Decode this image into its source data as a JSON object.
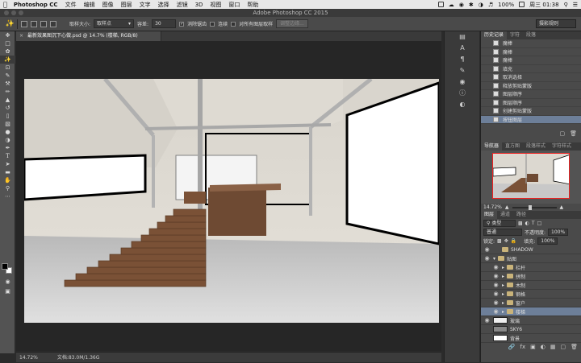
{
  "mac_menubar": {
    "app_name": "Photoshop CC",
    "menus": [
      "文件",
      "编辑",
      "图像",
      "图层",
      "文字",
      "选择",
      "滤镜",
      "3D",
      "视图",
      "窗口",
      "帮助"
    ],
    "battery": "100%",
    "clock": "周三 01:38"
  },
  "window": {
    "title": "Adobe Photoshop CC 2015"
  },
  "options_bar": {
    "brush_size_label": "画笔大小:",
    "sample_label": "取样大小:",
    "sample_value": "取样点",
    "tolerance_label": "容差:",
    "tolerance_value": "30",
    "antialias_label": "消除锯齿",
    "contiguous_label": "连续",
    "all_layers_label": "对所有图层取样",
    "refine_edge_label": "调整边缘...",
    "workspace": "摄影规则"
  },
  "document": {
    "tab_title": "最新效果图沉下心做.psd @ 14.7% (楼梯, RGB/8)",
    "zoom": "14.72%",
    "doc_size": "文档:83.0M/1.36G"
  },
  "history_panel": {
    "tabs": [
      "历史记录",
      "字符",
      "段落"
    ],
    "items": [
      "魔棒",
      "魔棒",
      "魔棒",
      "填充",
      "取消选择",
      "释放剪贴蒙版",
      "图层顺序",
      "图层顺序",
      "创建剪贴蒙版",
      "按钮图层"
    ]
  },
  "navigator_panel": {
    "tabs": [
      "导航器",
      "直方图",
      "段落样式",
      "字符样式"
    ],
    "zoom": "14.72%"
  },
  "layers_panel": {
    "tabs": [
      "图层",
      "通道",
      "路径"
    ],
    "kind_filter": "类型",
    "blend_mode": "普通",
    "opacity_label": "不透明度:",
    "opacity_value": "100%",
    "lock_label": "锁定:",
    "fill_label": "填充:",
    "fill_value": "100%",
    "layers": [
      {
        "name": "SHADOW"
      },
      {
        "name": "贴图"
      },
      {
        "name": "栏杆"
      },
      {
        "name": "拼制"
      },
      {
        "name": "木制"
      },
      {
        "name": "钢格"
      },
      {
        "name": "窗户"
      },
      {
        "name": "楼梯"
      },
      {
        "name": "玻璃"
      },
      {
        "name": "SKY6"
      },
      {
        "name": "背景"
      }
    ]
  },
  "colors": {
    "selection": "#6d7f99",
    "navigator_frame": "#e22222"
  }
}
